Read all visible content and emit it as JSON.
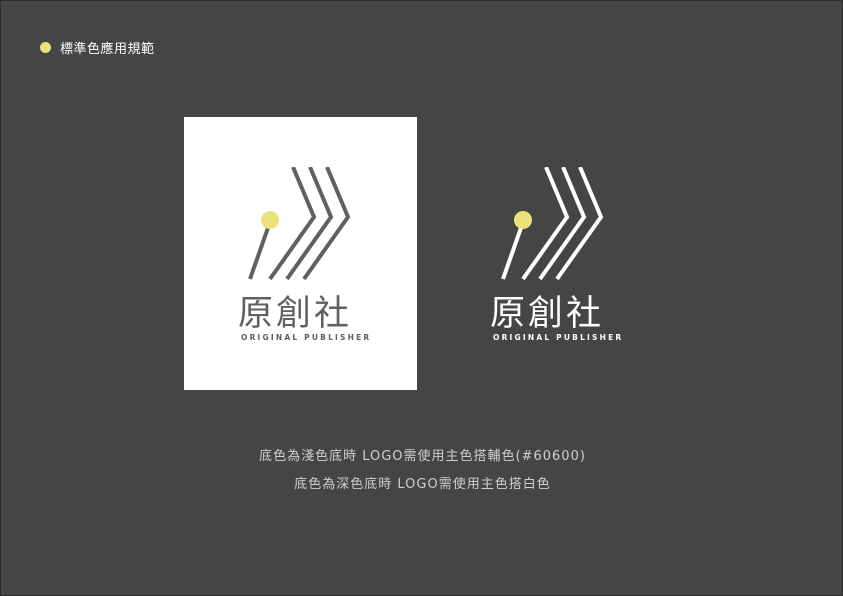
{
  "header": {
    "title": "標準色應用規範",
    "bullet_color": "#e8e37b"
  },
  "logo": {
    "name": "原創社",
    "tagline": "ORIGINAL PUBLISHER",
    "primary_color": "#606060",
    "accent_color": "#e8e37b",
    "reverse_color": "#ffffff"
  },
  "captions": {
    "line1": "底色為淺色底時 LOGO需使用主色搭輔色(#60600)",
    "line2": "底色為深色底時 LOGO需使用主色搭白色"
  }
}
